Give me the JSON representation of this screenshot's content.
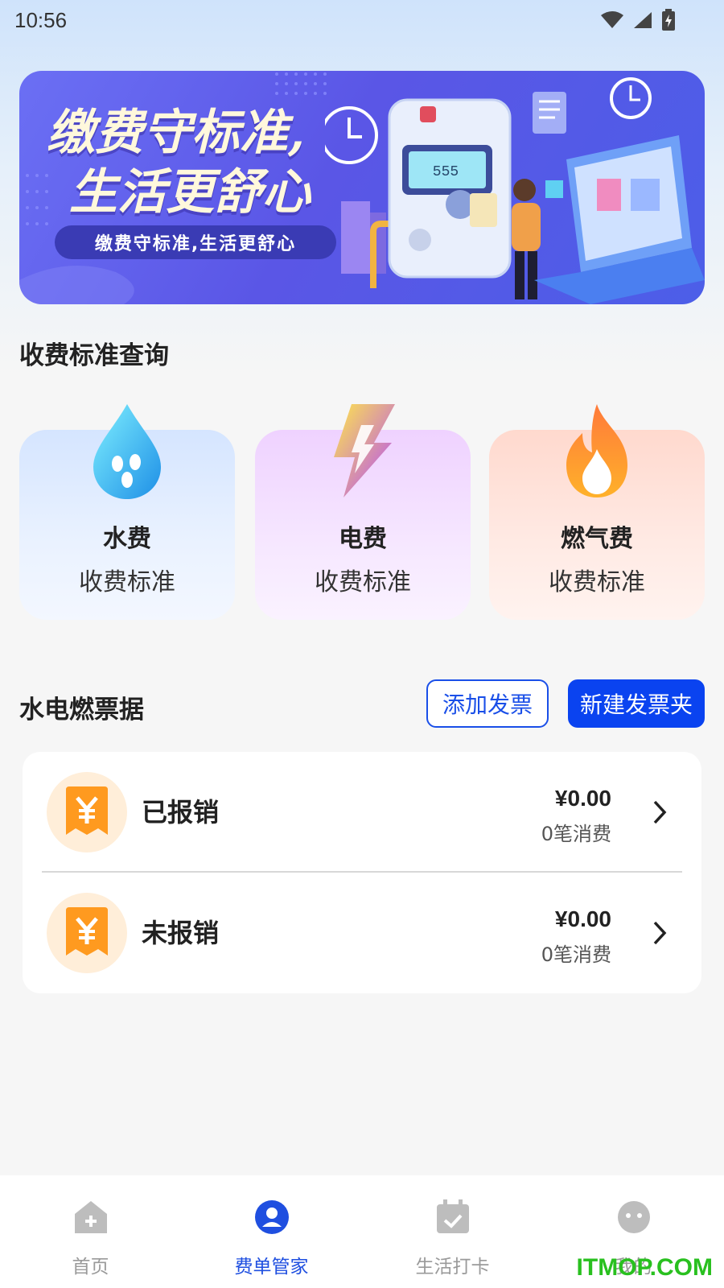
{
  "status_bar": {
    "time": "10:56"
  },
  "banner": {
    "headline_line1": "缴费守标准,",
    "headline_line2": "生活更舒心",
    "pill_text": "缴费守标准,生活更舒心"
  },
  "fee_standards": {
    "title": "收费标准查询",
    "items": [
      {
        "name": "水费",
        "sub": "收费标准",
        "icon": "water-drop-icon"
      },
      {
        "name": "电费",
        "sub": "收费标准",
        "icon": "lightning-icon"
      },
      {
        "name": "燃气费",
        "sub": "收费标准",
        "icon": "flame-icon"
      }
    ]
  },
  "receipts": {
    "title": "水电燃票据",
    "add_button": "添加发票",
    "new_folder_button": "新建发票夹",
    "rows": [
      {
        "label": "已报销",
        "amount": "¥0.00",
        "count": "0笔消费"
      },
      {
        "label": "未报销",
        "amount": "¥0.00",
        "count": "0笔消费"
      }
    ]
  },
  "tabbar": {
    "items": [
      {
        "label": "首页",
        "icon": "home-icon",
        "active": false
      },
      {
        "label": "费单管家",
        "icon": "bill-manager-icon",
        "active": true
      },
      {
        "label": "生活打卡",
        "icon": "calendar-check-icon",
        "active": false
      },
      {
        "label": "我的",
        "icon": "profile-icon",
        "active": false
      }
    ]
  },
  "watermark": "ITMOP.COM",
  "colors": {
    "accent": "#0a43f0",
    "tab_active": "#1f4fe0",
    "tab_inactive": "#9a9a9a",
    "receipt_orange": "#ff9a1f"
  }
}
